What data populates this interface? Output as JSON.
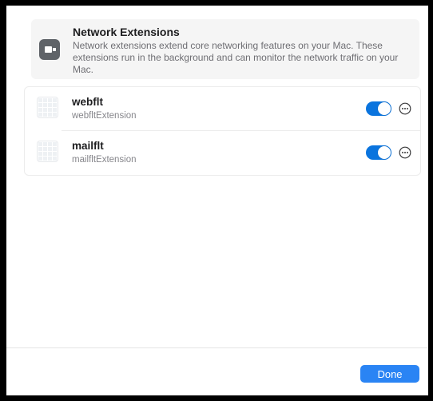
{
  "header": {
    "title": "Network Extensions",
    "description": "Network extensions extend core networking features on your Mac. These extensions run in the background and can monitor the network traffic on your Mac.",
    "icon": "network-extension-icon"
  },
  "extensions": [
    {
      "name": "webflt",
      "bundle": "webfltExtension",
      "enabled": true,
      "icon": "extension-placeholder-icon"
    },
    {
      "name": "mailflt",
      "bundle": "mailfltExtension",
      "enabled": true,
      "icon": "extension-placeholder-icon"
    }
  ],
  "footer": {
    "done_label": "Done"
  },
  "colors": {
    "accent": "#0a74de",
    "button": "#2a84f4"
  }
}
